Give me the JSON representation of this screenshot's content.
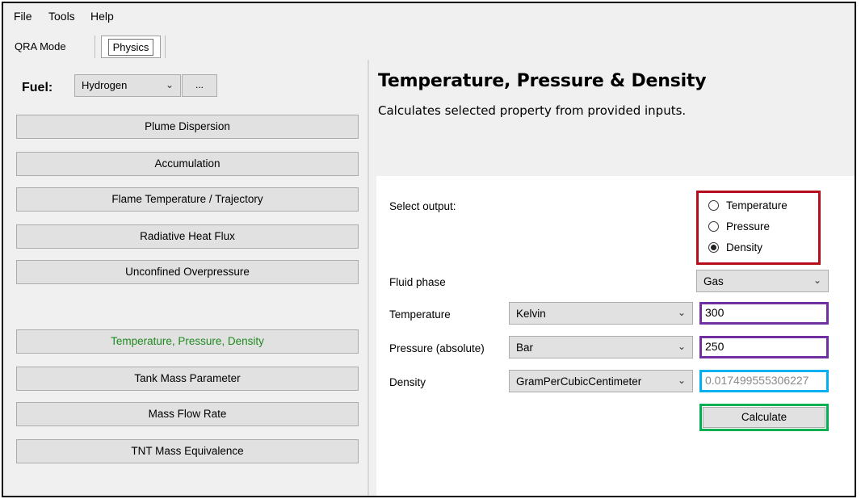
{
  "menu": {
    "file": "File",
    "tools": "Tools",
    "help": "Help"
  },
  "tabs": {
    "qra": "QRA Mode",
    "physics": "Physics"
  },
  "fuel": {
    "label": "Fuel:",
    "selected": "Hydrogen",
    "more_label": "..."
  },
  "nav_buttons": [
    "Plume Dispersion",
    "Accumulation",
    "Flame Temperature / Trajectory",
    "Radiative Heat Flux",
    "Unconfined Overpressure",
    "Temperature, Pressure, Density",
    "Tank Mass Parameter",
    "Mass Flow Rate",
    "TNT Mass Equivalence"
  ],
  "page": {
    "title": "Temperature, Pressure & Density",
    "subtitle": "Calculates selected property from provided inputs."
  },
  "form": {
    "select_output_label": "Select output:",
    "output_options": [
      "Temperature",
      "Pressure",
      "Density"
    ],
    "selected_output": "Density",
    "fluid_phase_label": "Fluid phase",
    "fluid_phase_value": "Gas",
    "temperature_label": "Temperature",
    "temperature_unit": "Kelvin",
    "temperature_value": "300",
    "pressure_label": "Pressure (absolute)",
    "pressure_unit": "Bar",
    "pressure_value": "250",
    "density_label": "Density",
    "density_unit": "GramPerCubicCentimeter",
    "density_value": "0.017499555306227",
    "calculate_label": "Calculate"
  },
  "colors": {
    "active_nav": "#1e8a1e",
    "output_highlight": "#b50e1a",
    "input_highlight": "#7030a0",
    "result_highlight": "#00b0f0",
    "calculate_highlight": "#00b050"
  }
}
